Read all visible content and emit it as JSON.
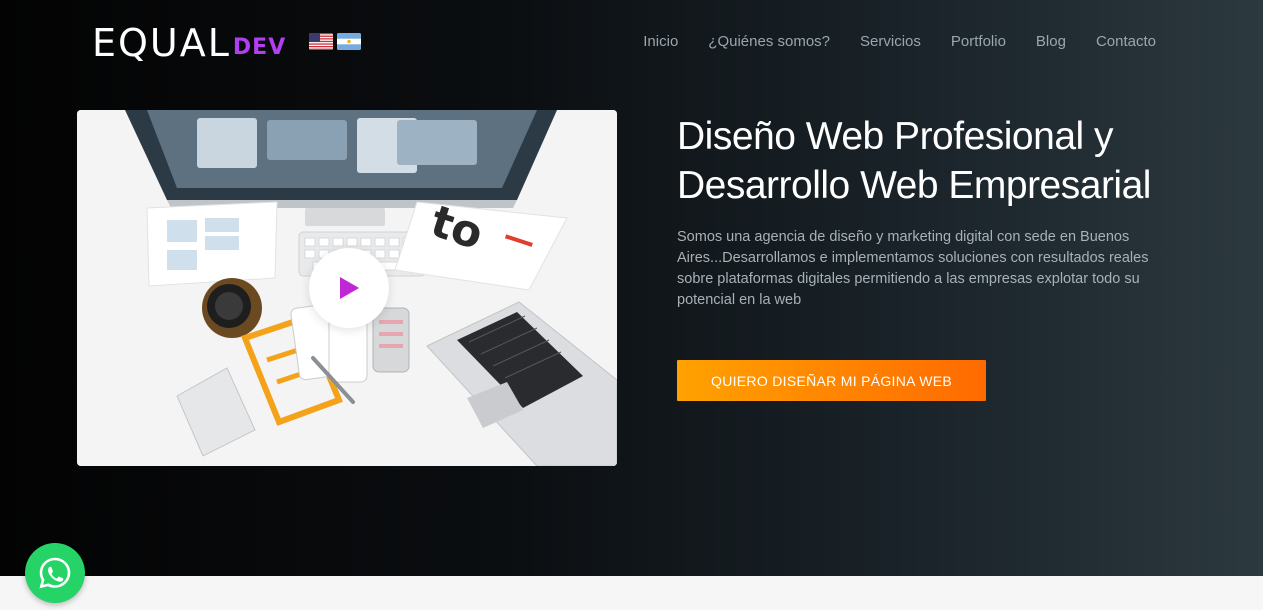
{
  "header": {
    "logo_main": "EQUAL",
    "logo_sub": "DEV",
    "nav": [
      {
        "label": "Inicio"
      },
      {
        "label": "¿Quiénes somos?"
      },
      {
        "label": "Servicios"
      },
      {
        "label": "Portfolio"
      },
      {
        "label": "Blog"
      },
      {
        "label": "Contacto"
      }
    ],
    "flags": [
      "us-flag-icon",
      "argentina-flag-icon"
    ]
  },
  "hero": {
    "headline": "Diseño Web Profesional y Desarrollo Web Empresarial",
    "description": "Somos una agencia de diseño y marketing digital con sede en Buenos Aires...Desarrollamos e implementamos soluciones con resultados reales sobre plataformas digitales permitiendo a las empresas explotar todo su potencial en la web",
    "cta_label": "QUIERO DISEÑAR MI PÁGINA WEB",
    "video_play_icon": "play-icon",
    "book_text": "to"
  },
  "colors": {
    "accent_purple": "#b33df0",
    "cta_start": "#ffa200",
    "cta_end": "#ff6a00",
    "whatsapp_green": "#25d366"
  },
  "floating": {
    "whatsapp_icon": "whatsapp-icon"
  }
}
